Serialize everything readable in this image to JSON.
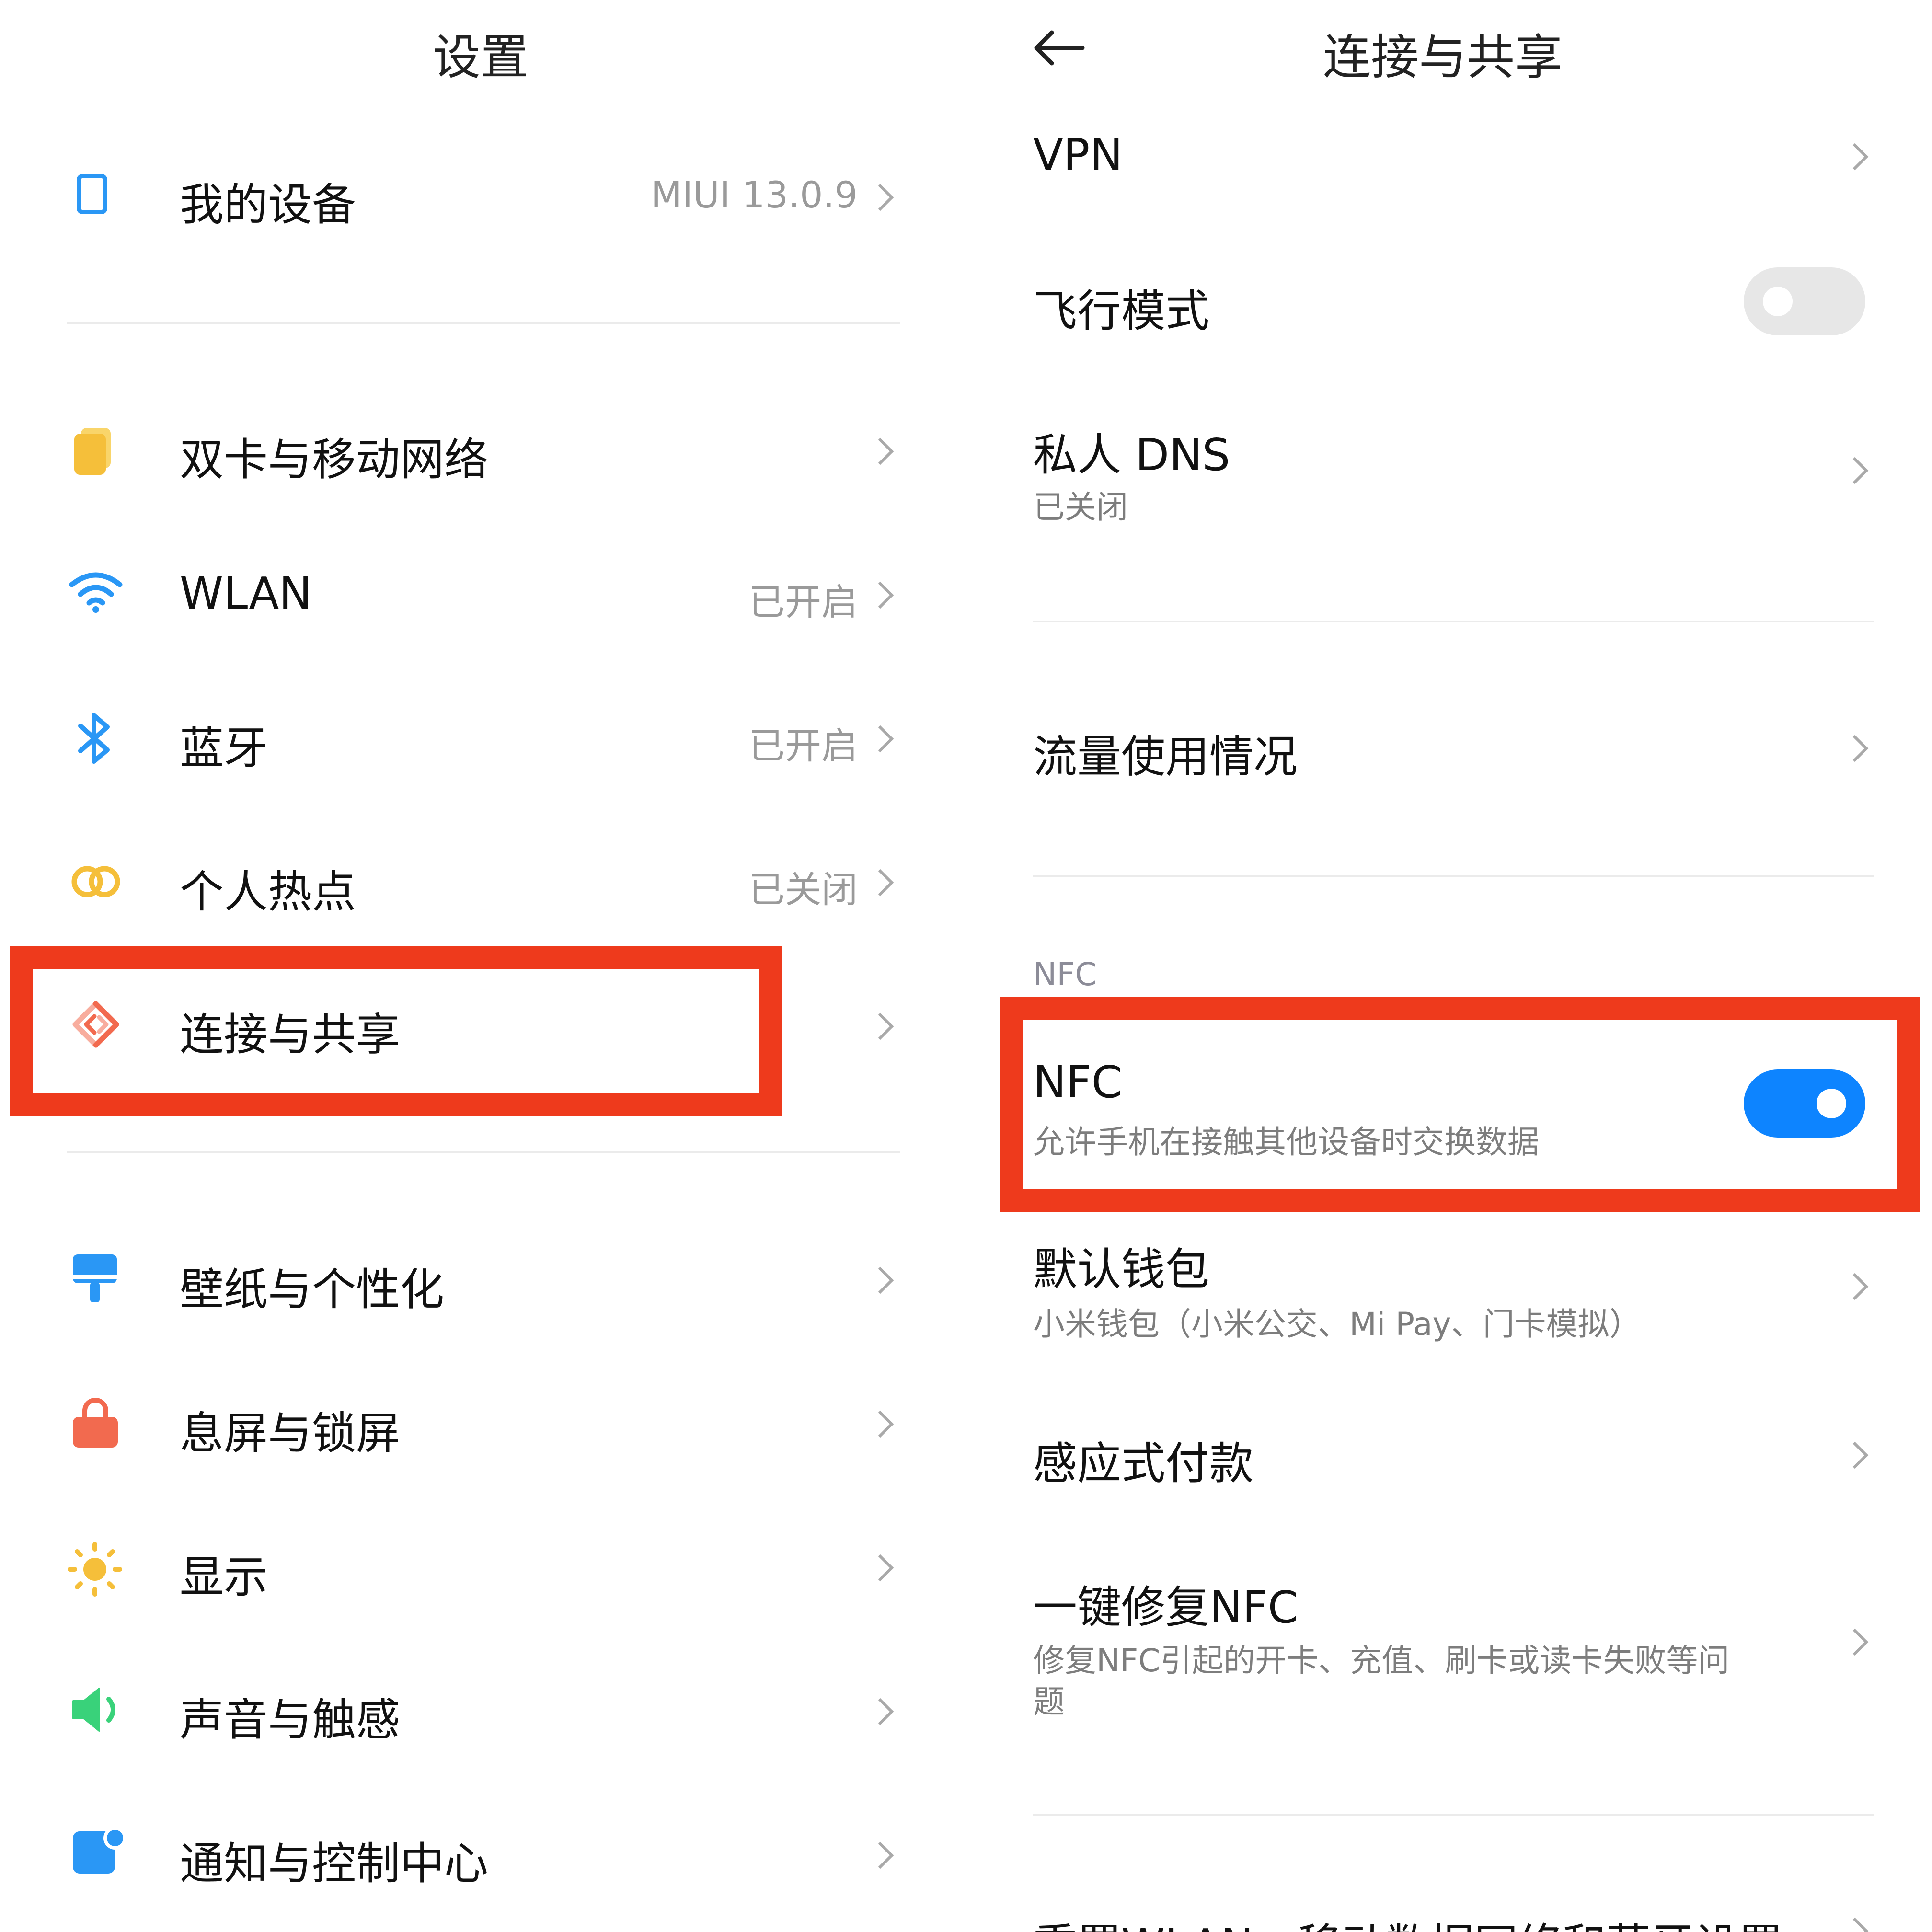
{
  "left": {
    "title": "设置",
    "device": {
      "label": "我的设备",
      "value": "MIUI 13.0.9"
    },
    "network_group": [
      {
        "label": "双卡与移动网络",
        "value": ""
      },
      {
        "label": "WLAN",
        "value": "已开启"
      },
      {
        "label": "蓝牙",
        "value": "已开启"
      },
      {
        "label": "个人热点",
        "value": "已关闭"
      },
      {
        "label": "连接与共享",
        "value": ""
      }
    ],
    "personal_group": [
      {
        "label": "壁纸与个性化"
      },
      {
        "label": "息屏与锁屏"
      },
      {
        "label": "显示"
      },
      {
        "label": "声音与触感"
      },
      {
        "label": "通知与控制中心"
      }
    ]
  },
  "right": {
    "title": "连接与共享",
    "vpn": {
      "label": "VPN"
    },
    "airplane": {
      "label": "飞行模式",
      "enabled": false
    },
    "private_dns": {
      "label": "私人 DNS",
      "subtitle": "已关闭"
    },
    "data_usage": {
      "label": "流量使用情况"
    },
    "nfc_section_label": "NFC",
    "nfc": {
      "label": "NFC",
      "subtitle": "允许手机在接触其他设备时交换数据",
      "enabled": true
    },
    "default_wallet": {
      "label": "默认钱包",
      "subtitle": "小米钱包（小米公交、Mi Pay、门卡模拟）"
    },
    "tap_to_pay": {
      "label": "感应式付款"
    },
    "nfc_repair": {
      "label": "一键修复NFC",
      "subtitle_line1": "修复NFC引起的开卡、充值、刷卡或读卡失败等问",
      "subtitle_line2": "题"
    },
    "reset_cut_off": {
      "label": "重置WLAN、移动数据网络和蓝牙设置"
    }
  },
  "colors": {
    "highlight": "#ee3a1c",
    "toggle_on": "#0d84ff",
    "toggle_off": "#e7e7e7",
    "icon_blue": "#2a97f5",
    "icon_yellow": "#f5bf3a",
    "icon_orange_red": "#f26a4f",
    "icon_green": "#39d27a"
  }
}
